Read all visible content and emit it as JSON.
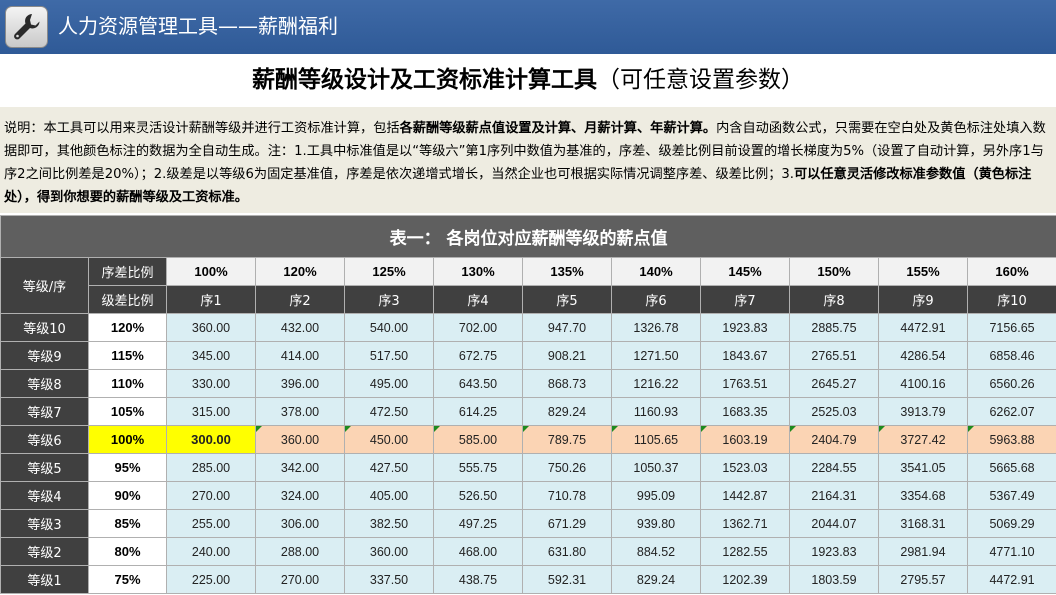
{
  "app": {
    "title": "人力资源管理工具——薪酬福利",
    "icon": "wrench-icon"
  },
  "page": {
    "title_bold": "薪酬等级设计及工资标准计算工具",
    "title_light": "（可任意设置参数）"
  },
  "description": {
    "part1": "说明：本工具可以用来灵活设计薪酬等级并进行工资标准计算，包括",
    "bold1": "各薪酬等级薪点值设置及计算、月薪计算、年薪计算。",
    "part2": "内含自动函数公式，只需要在空白处及黄色标注处填入数据即可，其他颜色标注的数据为全自动生成。注：1.工具中标准值是以“等级六”第1序列中数值为基准的，序差、级差比例目前设置的增长梯度为5%（设置了自动计算，另外序1与序2之间比例差是20%）；2.级差是以等级6为固定基准值，序差是依次递增式增长，当然企业也可根据实际情况调整序差、级差比例；3.",
    "bold2": "可以任意灵活修改标准参数值（黄色标注处），得到你想要的薪酬等级及工资标准。"
  },
  "table": {
    "caption": "表一：  各岗位对应薪酬等级的薪点值",
    "corner_label": "等级/序",
    "seq_ratio_label": "序差比例",
    "grade_ratio_label": "级差比例",
    "seq_ratios": [
      "100%",
      "120%",
      "125%",
      "130%",
      "135%",
      "140%",
      "145%",
      "150%",
      "155%",
      "160%"
    ],
    "seq_names": [
      "序1",
      "序2",
      "序3",
      "序4",
      "序5",
      "序6",
      "序7",
      "序8",
      "序9",
      "序10"
    ],
    "rows": [
      {
        "grade": "等级10",
        "ratio": "120%",
        "values": [
          "360.00",
          "432.00",
          "540.00",
          "702.00",
          "947.70",
          "1326.78",
          "1923.83",
          "2885.75",
          "4472.91",
          "7156.65"
        ]
      },
      {
        "grade": "等级9",
        "ratio": "115%",
        "values": [
          "345.00",
          "414.00",
          "517.50",
          "672.75",
          "908.21",
          "1271.50",
          "1843.67",
          "2765.51",
          "4286.54",
          "6858.46"
        ]
      },
      {
        "grade": "等级8",
        "ratio": "110%",
        "values": [
          "330.00",
          "396.00",
          "495.00",
          "643.50",
          "868.73",
          "1216.22",
          "1763.51",
          "2645.27",
          "4100.16",
          "6560.26"
        ]
      },
      {
        "grade": "等级7",
        "ratio": "105%",
        "values": [
          "315.00",
          "378.00",
          "472.50",
          "614.25",
          "829.24",
          "1160.93",
          "1683.35",
          "2525.03",
          "3913.79",
          "6262.07"
        ]
      },
      {
        "grade": "等级6",
        "ratio": "100%",
        "values": [
          "300.00",
          "360.00",
          "450.00",
          "585.00",
          "789.75",
          "1105.65",
          "1603.19",
          "2404.79",
          "3727.42",
          "5963.88"
        ]
      },
      {
        "grade": "等级5",
        "ratio": "95%",
        "values": [
          "285.00",
          "342.00",
          "427.50",
          "555.75",
          "750.26",
          "1050.37",
          "1523.03",
          "2284.55",
          "3541.05",
          "5665.68"
        ]
      },
      {
        "grade": "等级4",
        "ratio": "90%",
        "values": [
          "270.00",
          "324.00",
          "405.00",
          "526.50",
          "710.78",
          "995.09",
          "1442.87",
          "2164.31",
          "3354.68",
          "5367.49"
        ]
      },
      {
        "grade": "等级3",
        "ratio": "85%",
        "values": [
          "255.00",
          "306.00",
          "382.50",
          "497.25",
          "671.29",
          "939.80",
          "1362.71",
          "2044.07",
          "3168.31",
          "5069.29"
        ]
      },
      {
        "grade": "等级2",
        "ratio": "80%",
        "values": [
          "240.00",
          "288.00",
          "360.00",
          "468.00",
          "631.80",
          "884.52",
          "1282.55",
          "1923.83",
          "2981.94",
          "4771.10"
        ]
      },
      {
        "grade": "等级1",
        "ratio": "75%",
        "values": [
          "225.00",
          "270.00",
          "337.50",
          "438.75",
          "592.31",
          "829.24",
          "1202.39",
          "1803.59",
          "2795.57",
          "4472.91"
        ]
      }
    ],
    "colors": {
      "header_dark": "#404040",
      "caption_bg": "#5f5f5f",
      "value_bg": "#daeef3",
      "base_row_bg": "#fbd4b4",
      "editable_yellow": "#ffff00"
    }
  }
}
